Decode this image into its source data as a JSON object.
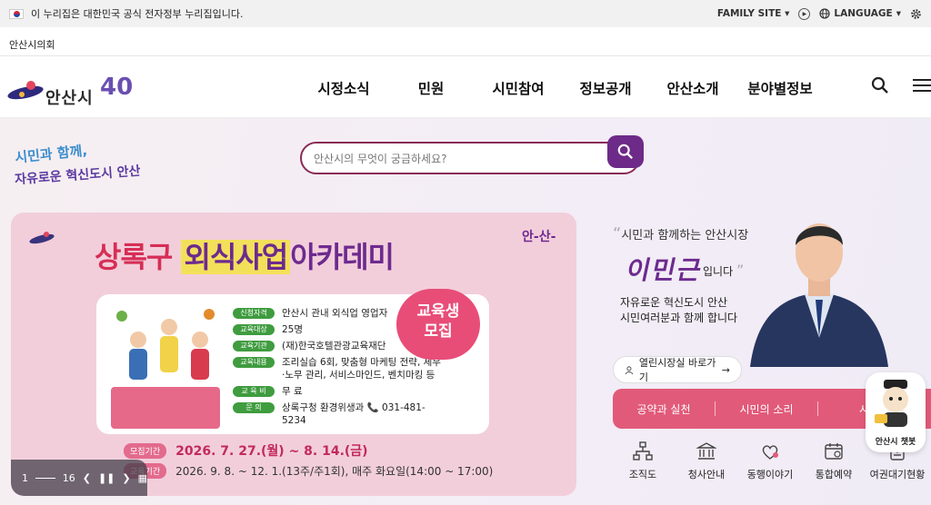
{
  "topbar": {
    "notice": "이 누리집은 대한민국 공식 전자정부 누리집입니다.",
    "family_site": "FAMILY SITE",
    "language": "LANGUAGE"
  },
  "council": {
    "label": "안산시의회"
  },
  "logo": {
    "text": "안산시",
    "badge": "40"
  },
  "nav": {
    "items": [
      "시정소식",
      "민원",
      "시민참여",
      "정보공개",
      "안산소개",
      "분야별정보"
    ]
  },
  "slogan": {
    "line1": "시민과 함께,",
    "line2": "자유로운 혁신도시 안산"
  },
  "search": {
    "placeholder": "안산시의 무엇이 궁금하세요?"
  },
  "banner": {
    "title_a": "상록구",
    "title_b": "외식사업",
    "title_c": "아카데미",
    "brand": "안-산-",
    "bubble_line1": "교육생",
    "bubble_line2": "모집",
    "info": [
      {
        "tag": "신청자격",
        "text": "안산시 관내 외식업 영업자"
      },
      {
        "tag": "교육대상",
        "text": "25명"
      },
      {
        "tag": "교육기관",
        "text": "(재)한국호텔관광교육재단"
      },
      {
        "tag": "교육내용",
        "text": "조리실습 6회, 맞춤형 마케팅 전략, 세무·노무 관리, 서비스마인드, 벤치마킹 등"
      },
      {
        "tag": "교 육 비",
        "text": "무 료"
      },
      {
        "tag": "문 의",
        "text": "상록구청 환경위생과 📞 031-481-5234"
      }
    ],
    "recruit_label": "모집기간",
    "recruit_value": "2026. 7. 27.(월) ~ 8. 14.(금)",
    "edu_label": "교육기간",
    "edu_value": "2026. 9. 8. ~ 12. 1.(13주/주1회), 매주 화요일(14:00 ~ 17:00)",
    "slide_current": "1",
    "slide_total": "16"
  },
  "mayor": {
    "quote": "시민과 함께하는 안산시장",
    "name": "이민근",
    "suffix": "입니다",
    "desc1": "자유로운 혁신도시 안산",
    "desc2": "시민여러분과 함께 합니다",
    "office_button": "열린시장실 바로가기"
  },
  "pink_tabs": [
    "공약과 실천",
    "시민의 소리",
    "시민"
  ],
  "quick": [
    {
      "label": "조직도",
      "icon": "org-chart-icon"
    },
    {
      "label": "청사안내",
      "icon": "building-icon"
    },
    {
      "label": "동행이야기",
      "icon": "heart-people-icon"
    },
    {
      "label": "통합예약",
      "icon": "calendar-icon"
    },
    {
      "label": "여권대기현황",
      "icon": "passport-icon"
    }
  ],
  "chatbot": {
    "label": "안산시 챗봇"
  },
  "colors": {
    "accent": "#6d2a88",
    "pink": "#e25a7a",
    "banner_bg": "#f2cedb"
  }
}
